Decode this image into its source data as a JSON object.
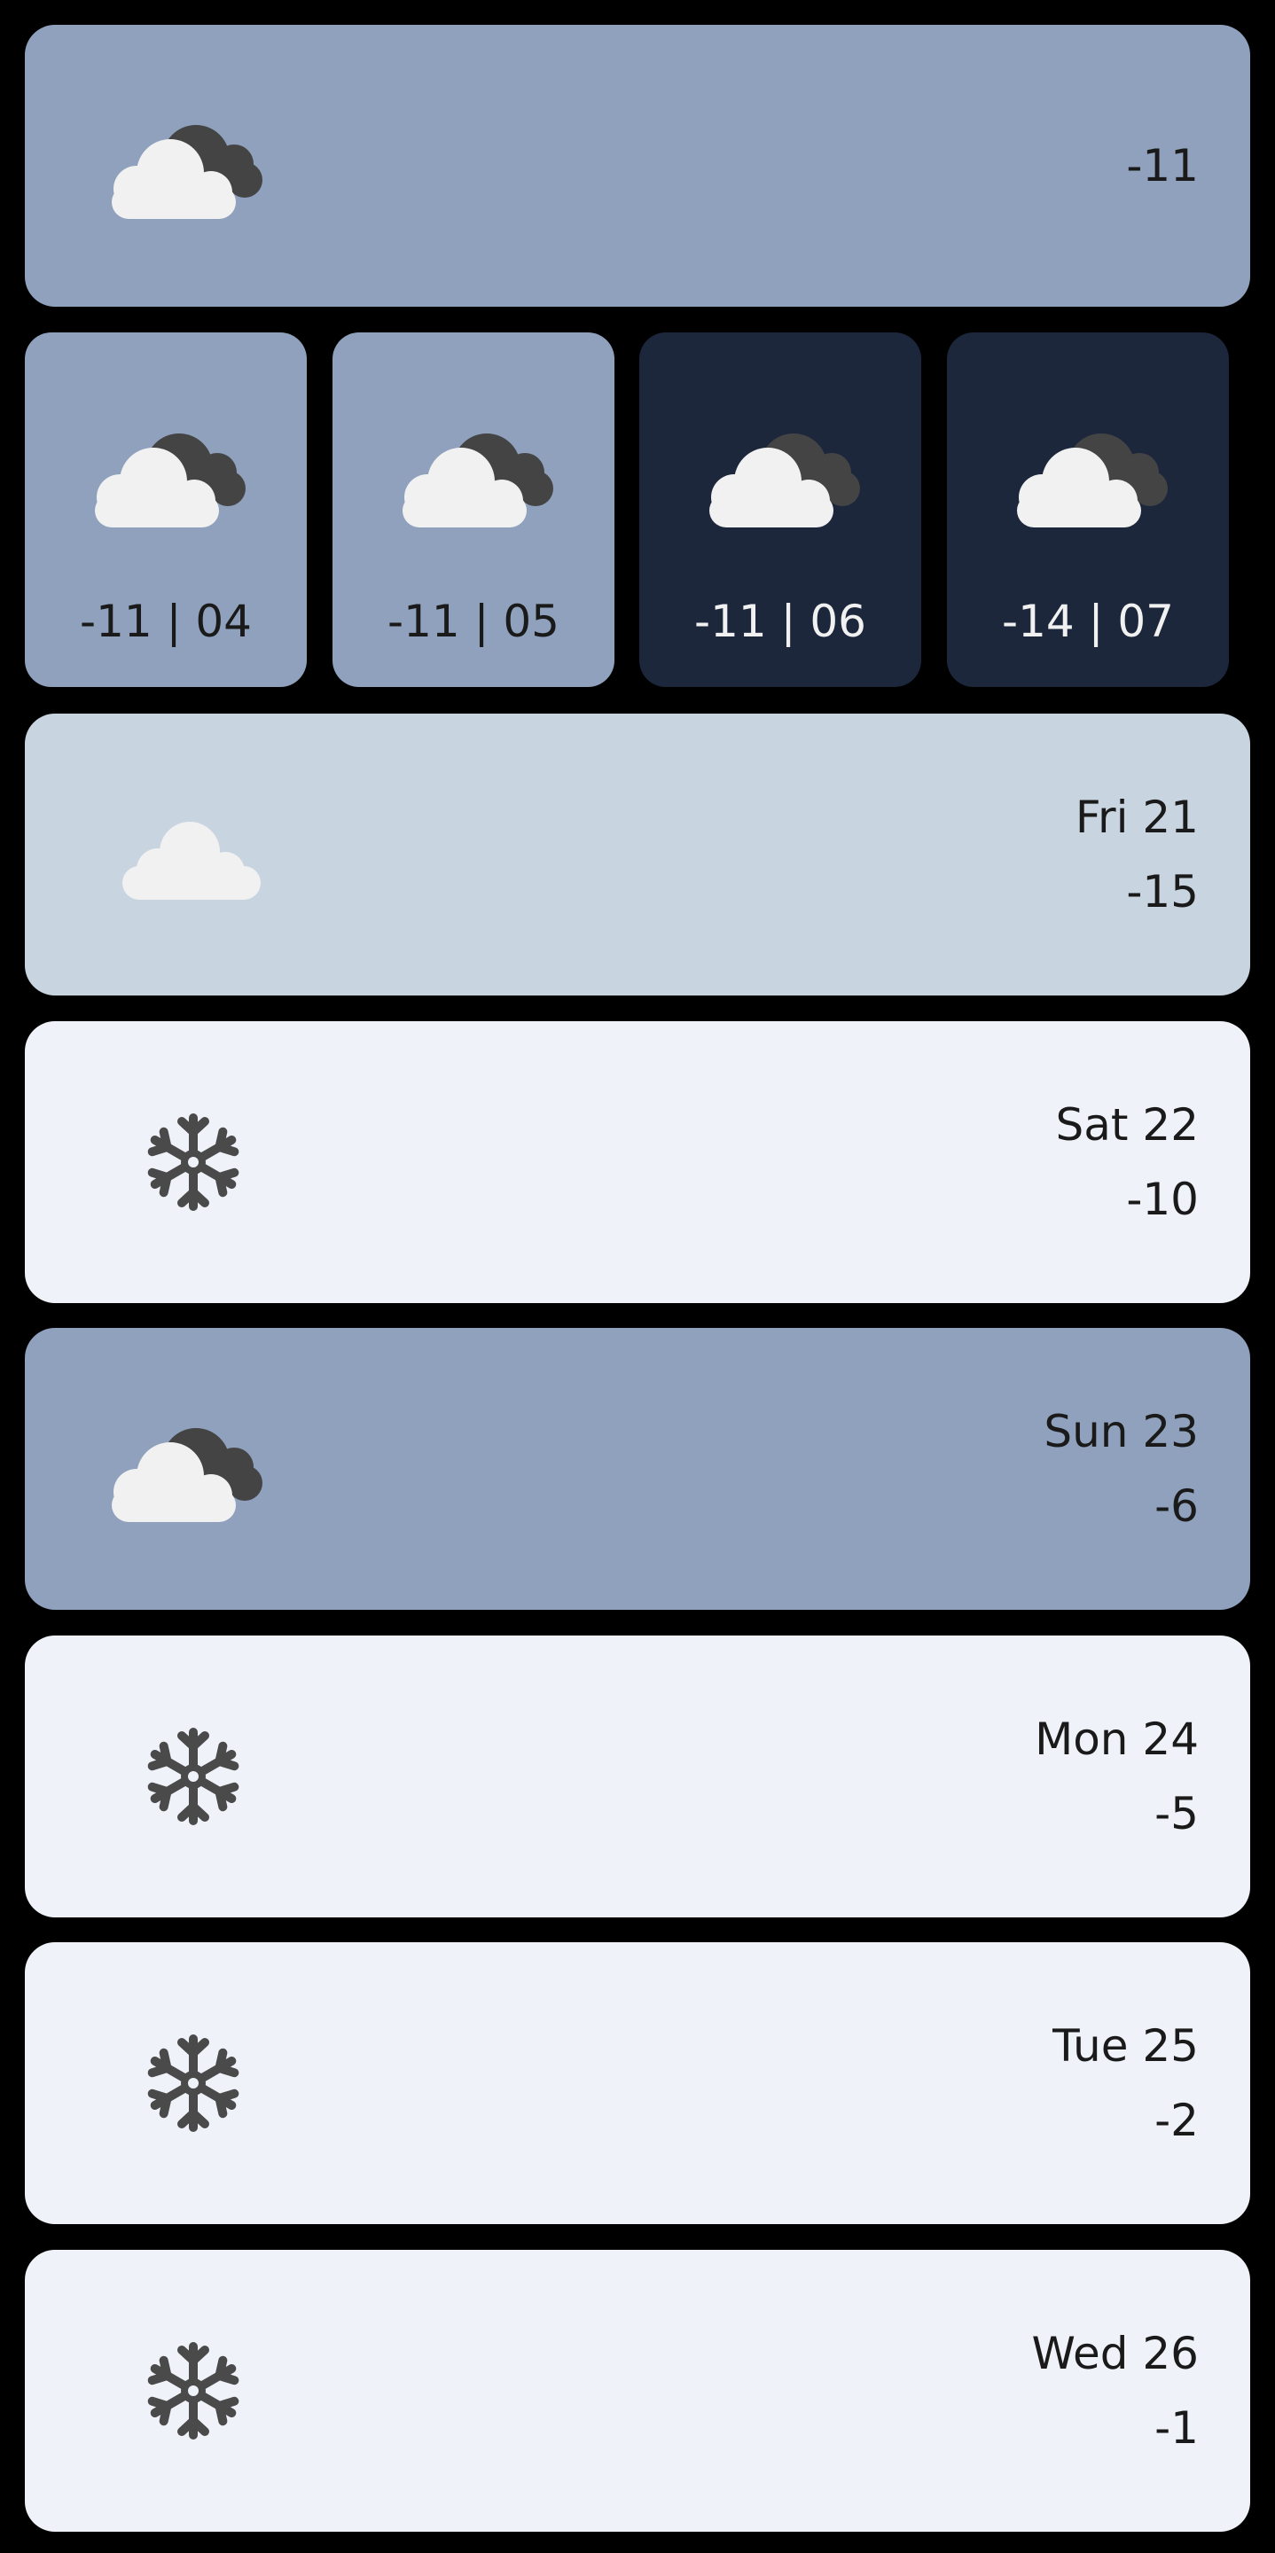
{
  "colors": {
    "overcast": "#8fa1bc",
    "night": "#1c273c",
    "cloudy": "#c8d5e1",
    "snow": "#eff3f9",
    "cloud_white": "#f1f1f1",
    "cloud_dark": "#444444",
    "snowflake": "#4a4a4a"
  },
  "current": {
    "icon": "partly-cloudy-icon",
    "temp": "-11"
  },
  "hourly": [
    {
      "label": "-11 | 04",
      "icon": "partly-cloudy-icon",
      "theme": "day"
    },
    {
      "label": "-11 | 05",
      "icon": "partly-cloudy-icon",
      "theme": "day"
    },
    {
      "label": "-11 | 06",
      "icon": "partly-cloudy-icon",
      "theme": "night"
    },
    {
      "label": "-14 | 07",
      "icon": "partly-cloudy-icon",
      "theme": "night"
    }
  ],
  "daily": [
    {
      "day": "Fri 21",
      "temp": "-15",
      "icon": "cloud-icon"
    },
    {
      "day": "Sat 22",
      "temp": "-10",
      "icon": "snowflake-icon"
    },
    {
      "day": "Sun 23",
      "temp": "-6",
      "icon": "partly-cloudy-icon"
    },
    {
      "day": "Mon 24",
      "temp": "-5",
      "icon": "snowflake-icon"
    },
    {
      "day": "Tue 25",
      "temp": "-2",
      "icon": "snowflake-icon"
    },
    {
      "day": "Wed 26",
      "temp": "-1",
      "icon": "snowflake-icon"
    }
  ]
}
